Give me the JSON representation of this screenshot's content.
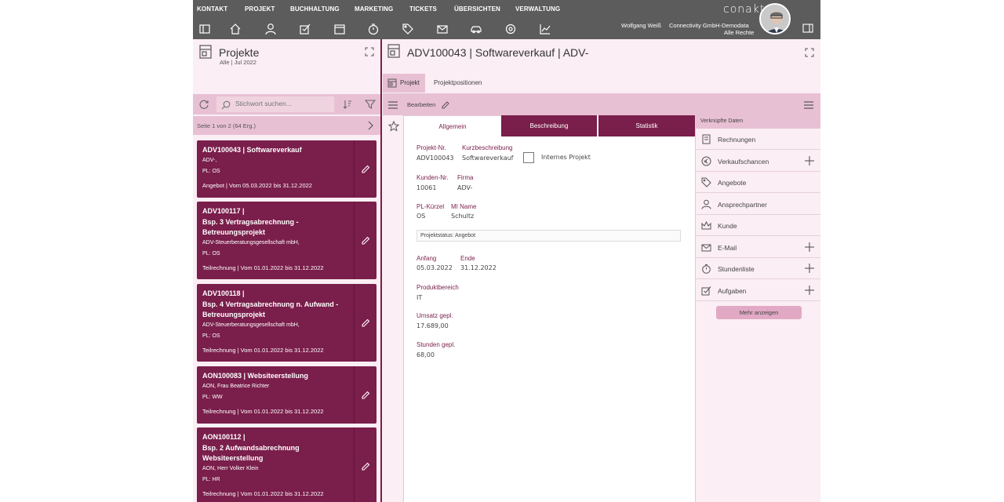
{
  "menu": [
    "KONTAKT",
    "PROJEKT",
    "BUCHHALTUNG",
    "MARKETING",
    "TICKETS",
    "ÜBERSICHTEN",
    "VERWALTUNG"
  ],
  "toolbar_icons": [
    "panel-left-icon",
    "home-icon",
    "contacts-icon",
    "tasks-icon",
    "calendar-icon",
    "timer-icon",
    "tag-icon",
    "mail-icon",
    "car-icon",
    "settings-icon",
    "chart-icon"
  ],
  "brand": {
    "logo": "conakt"
  },
  "user": {
    "name": "Wolfgang Weiß",
    "company": "Connectivity GmbH-Demodata",
    "rights": "Alle Rechte"
  },
  "left": {
    "title": "Projekte",
    "subtitle": "Alle | Jul 2022",
    "search_placeholder": "Stichwort suchen...",
    "pager": "Seite 1 von 2 (64 Erg.)",
    "cards": [
      {
        "title": "ADV100043 | Softwareverkauf",
        "lines": [
          "ADV-,",
          "PL: OS"
        ],
        "status": "Angebot | Vom 05.03.2022 bis 31.12.2022"
      },
      {
        "title": "ADV100117 |\nBsp. 3 Vertragsabrechnung -\nBetreuungsprojekt",
        "lines": [
          "ADV-Steuerberatungsgesellschaft mbH,",
          "PL: OS"
        ],
        "status": "Teilrechnung | Vom 01.01.2022 bis 31.12.2022"
      },
      {
        "title": "ADV100118 |\nBsp. 4 Vertragsabrechnung n. Aufwand -\nBetreuungsprojekt",
        "lines": [
          "ADV-Steuerberatungsgesellschaft mbH,",
          "PL: OS"
        ],
        "status": "Teilrechnung | Vom 01.01.2022 bis 31.12.2022"
      },
      {
        "title": "AON100083 | Websiteerstellung",
        "lines": [
          "AON,  Frau Beatrice Richter",
          "PL: WW"
        ],
        "status": "Teilrechnung | Vom 01.01.2022 bis 31.12.2022"
      },
      {
        "title": "AON100112 |\nBsp. 2 Aufwandsabrechnung\nWebsiteerstellung",
        "lines": [
          "AON,  Herr Volker Klein",
          "PL: HR"
        ],
        "status": "Teilrechnung | Vom 01.01.2022 bis 31.12.2022"
      }
    ]
  },
  "detail": {
    "title": "ADV100043 | Softwareverkauf | ADV-",
    "tabs": [
      "Projekt",
      "Projektpositionen"
    ],
    "edit_label": "Bearbeiten",
    "subtabs": [
      "Allgemein",
      "Beschreibung",
      "Statistik"
    ],
    "fields": {
      "projekt_nr_label": "Projekt-Nr.",
      "projekt_nr": "ADV100043",
      "kurz_label": "Kurzbeschreibung",
      "kurz": "Softwareverkauf",
      "intern_label": "Internes Projekt",
      "kunden_nr_label": "Kunden-Nr.",
      "kunden_nr": "10061",
      "firma_label": "Firma",
      "firma": "ADV-",
      "pl_label": "PL-Kürzel",
      "pl": "OS",
      "mi_label": "MI Name",
      "mi": "Schultz",
      "status": "Projektstatus: Angebot",
      "anfang_label": "Anfang",
      "anfang": "05.03.2022",
      "ende_label": "Ende",
      "ende": "31.12.2022",
      "produkt_label": "Produktbereich",
      "produkt": "IT",
      "umsatz_label": "Umsatz gepl.",
      "umsatz": "17.689,00",
      "stunden_label": "Stunden gepl.",
      "stunden": "68,00"
    }
  },
  "linked": {
    "title": "Verknüpfte Daten",
    "items": [
      {
        "label": "Rechnungen",
        "icon": "invoice-icon",
        "plus": false
      },
      {
        "label": "Verkaufschancen",
        "icon": "euro-icon",
        "plus": true
      },
      {
        "label": "Angebote",
        "icon": "tag-icon",
        "plus": false
      },
      {
        "label": "Ansprechpartner",
        "icon": "person-icon",
        "plus": false
      },
      {
        "label": "Kunde",
        "icon": "crown-icon",
        "plus": false
      },
      {
        "label": "E-Mail",
        "icon": "mail-icon",
        "plus": true
      },
      {
        "label": "Stundenliste",
        "icon": "timer-icon",
        "plus": true
      },
      {
        "label": "Aufgaben",
        "icon": "tasks-icon",
        "plus": true
      }
    ],
    "more": "Mehr anzeigen"
  }
}
